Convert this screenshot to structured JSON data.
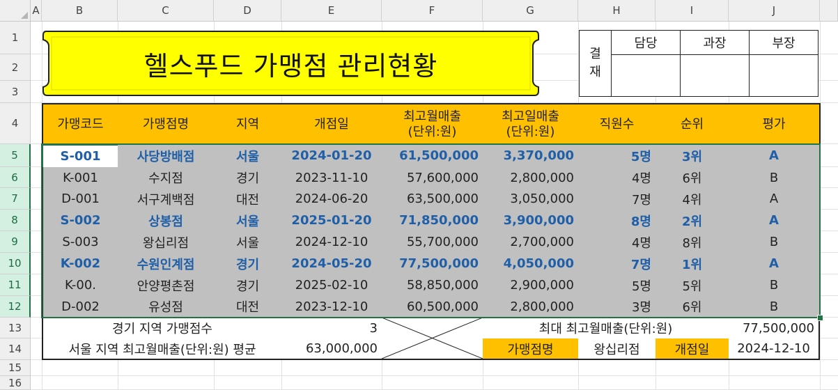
{
  "sheet": {
    "columns": [
      "A",
      "B",
      "C",
      "D",
      "E",
      "F",
      "G",
      "H",
      "I",
      "J"
    ],
    "rows": [
      "1",
      "2",
      "3",
      "4",
      "5",
      "6",
      "7",
      "8",
      "9",
      "10",
      "11",
      "12",
      "13",
      "14",
      "15",
      "16"
    ]
  },
  "title": "헬스푸드 가맹점 관리현황",
  "approval": {
    "label_top": "결",
    "label_bottom": "재",
    "roles": [
      "담당",
      "과장",
      "부장"
    ]
  },
  "table": {
    "headers": [
      "가맹코드",
      "가맹점명",
      "지역",
      "개점일",
      "최고월매출\n(단위:원)",
      "최고일매출\n(단위:원)",
      "직원수",
      "순위",
      "평가"
    ],
    "rows": [
      {
        "code": "S-001",
        "name": "사당방배점",
        "region": "서울",
        "open": "2024-01-20",
        "month": "61,500,000",
        "day": "3,370,000",
        "staff": "5명",
        "rank": "3위",
        "grade": "A",
        "hl": true
      },
      {
        "code": "K-001",
        "name": "수지점",
        "region": "경기",
        "open": "2023-11-10",
        "month": "57,600,000",
        "day": "2,800,000",
        "staff": "4명",
        "rank": "6위",
        "grade": "B",
        "hl": false
      },
      {
        "code": "D-001",
        "name": "서구계백점",
        "region": "대전",
        "open": "2024-06-20",
        "month": "63,500,000",
        "day": "3,050,000",
        "staff": "7명",
        "rank": "4위",
        "grade": "A",
        "hl": false
      },
      {
        "code": "S-002",
        "name": "상봉점",
        "region": "서울",
        "open": "2025-01-20",
        "month": "71,850,000",
        "day": "3,900,000",
        "staff": "8명",
        "rank": "2위",
        "grade": "A",
        "hl": true
      },
      {
        "code": "S-003",
        "name": "왕십리점",
        "region": "서울",
        "open": "2024-12-10",
        "month": "55,700,000",
        "day": "2,700,000",
        "staff": "4명",
        "rank": "8위",
        "grade": "B",
        "hl": false
      },
      {
        "code": "K-002",
        "name": "수원인계점",
        "region": "경기",
        "open": "2024-05-20",
        "month": "77,500,000",
        "day": "4,050,000",
        "staff": "7명",
        "rank": "1위",
        "grade": "A",
        "hl": true
      },
      {
        "code": "K-00.",
        "name": "안양평촌점",
        "region": "경기",
        "open": "2025-02-10",
        "month": "58,850,000",
        "day": "2,900,000",
        "staff": "5명",
        "rank": "5위",
        "grade": "B",
        "hl": false
      },
      {
        "code": "D-002",
        "name": "유성점",
        "region": "대전",
        "open": "2023-12-10",
        "month": "60,500,000",
        "day": "2,800,000",
        "staff": "3명",
        "rank": "6위",
        "grade": "B",
        "hl": false
      }
    ]
  },
  "summary": {
    "gyeonggi_label": "경기 지역 가맹점수",
    "gyeonggi_value": "3",
    "seoul_label": "서울 지역 최고월매출(단위:원) 평균",
    "seoul_value": "63,000,000",
    "max_label": "최대 최고월매출(단위:원)",
    "max_value": "77,500,000",
    "lookup_name_label": "가맹점명",
    "lookup_name_value": "왕십리점",
    "lookup_date_label": "개점일",
    "lookup_date_value": "2024-12-10"
  },
  "colors": {
    "header_bg": "#ffc000",
    "body_bg": "#c0c0c0",
    "title_bg": "#ffff00",
    "highlight_text": "#1f5fa8",
    "selection": "#217346"
  }
}
